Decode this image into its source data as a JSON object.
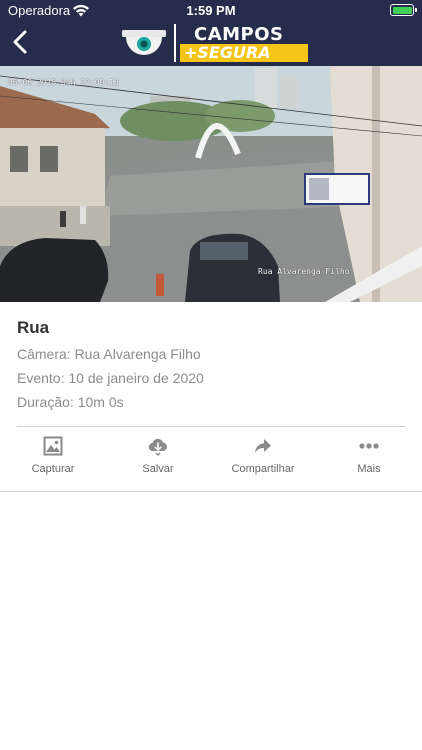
{
  "status_bar": {
    "carrier": "Operadora",
    "time": "1:59 PM",
    "wifi_icon": "wifi-icon",
    "battery_icon": "battery-charging-icon",
    "battery_color": "#3fcf56"
  },
  "header": {
    "back_icon": "chevron-left-icon",
    "logo_line1": "CAMPOS",
    "logo_line2": "+SEGURA",
    "background_color": "#262d4c",
    "accent_color": "#f5c518"
  },
  "video": {
    "timestamp_overlay": "06-06 2018 04h 22:09:13",
    "location_overlay": "Rua Alvarenga Filho"
  },
  "details": {
    "title": "Rua",
    "camera": "Câmera: Rua Alvarenga Filho",
    "event": "Evento: 10 de janeiro de 2020",
    "duration": "Duração: 10m 0s"
  },
  "actions": [
    {
      "label": "Capturar",
      "icon": "image-icon"
    },
    {
      "label": "Salvar",
      "icon": "cloud-download-icon"
    },
    {
      "label": "Compartilhar",
      "icon": "share-icon"
    },
    {
      "label": "Mais",
      "icon": "more-icon"
    }
  ]
}
